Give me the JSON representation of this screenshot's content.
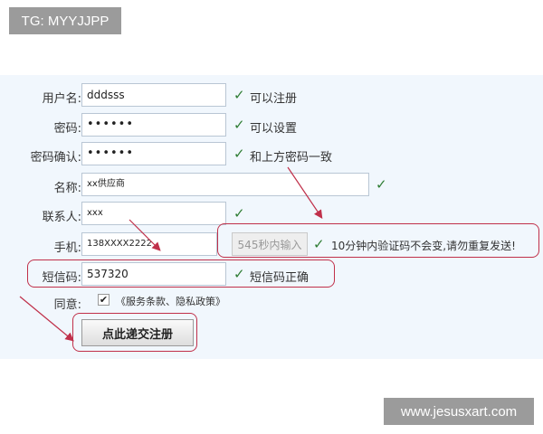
{
  "watermarks": {
    "top": "TG: MYYJJPP",
    "bottom": "www.jesusxart.com"
  },
  "form": {
    "username": {
      "label": "用户名:",
      "value": "dddsss",
      "hint": "可以注册"
    },
    "password": {
      "label": "密码:",
      "value": "••••••",
      "hint": "可以设置"
    },
    "confirm": {
      "label": "密码确认:",
      "value": "••••••",
      "hint": "和上方密码一致"
    },
    "name": {
      "label": "名称:",
      "value": "xx供应商"
    },
    "contact": {
      "label": "联系人:",
      "value": "xxx"
    },
    "phone": {
      "label": "手机:",
      "value": "138XXXX2222",
      "button": "545秒内输入",
      "hint": "10分钟内验证码不会变,请勿重复发送!"
    },
    "sms": {
      "label": "短信码:",
      "value": "537320",
      "hint": "短信码正确"
    },
    "agree": {
      "label": "同意:",
      "terms": "《服务条款、隐私政策》",
      "checked": "✔"
    },
    "submit": "点此递交注册"
  },
  "check_mark": "✓",
  "colors": {
    "panel": "#f1f7fd",
    "annotation": "#c0304a",
    "check": "#2f7d34"
  }
}
